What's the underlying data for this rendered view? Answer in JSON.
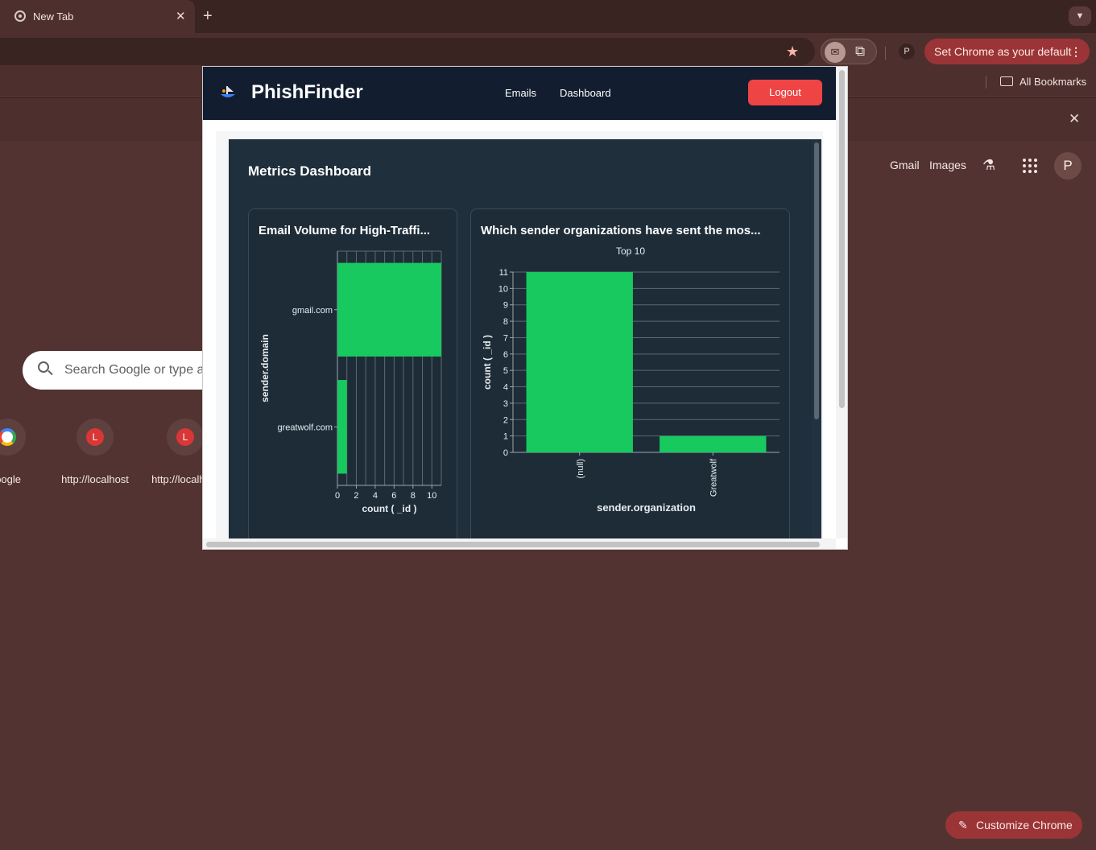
{
  "browser": {
    "tab_title": "New Tab",
    "default_button": "Set Chrome as your default",
    "profile_initial": "P",
    "all_bookmarks": "All Bookmarks"
  },
  "ntp": {
    "gmail": "Gmail",
    "images": "Images",
    "avatar": "P",
    "search_placeholder": "Search Google or type a URL",
    "shortcuts": [
      {
        "label": "Google"
      },
      {
        "label": "http://localhost",
        "letter": "L"
      },
      {
        "label": "http://localhost",
        "letter": "L"
      }
    ],
    "customize": "Customize Chrome"
  },
  "app": {
    "brand": "PhishFinder",
    "nav": {
      "emails": "Emails",
      "dashboard": "Dashboard"
    },
    "logout": "Logout",
    "dashboard_title": "Metrics Dashboard",
    "colors": {
      "bar": "#17c95e",
      "header": "#121d2f",
      "logout": "#ef4444"
    }
  },
  "chart_data": [
    {
      "type": "bar",
      "orientation": "horizontal",
      "title": "Email Volume for High-Traffi...",
      "categories": [
        "gmail.com",
        "greatwolf.com"
      ],
      "values": [
        11,
        1
      ],
      "xlabel": "count ( _id )",
      "ylabel": "sender.domain",
      "xlim": [
        0,
        11
      ],
      "xticks": [
        0,
        2,
        4,
        6,
        8,
        10
      ],
      "grid": true
    },
    {
      "type": "bar",
      "title": "Which sender organizations have sent the mos...",
      "subtitle": "Top 10",
      "categories": [
        "(null)",
        "Greatwolf"
      ],
      "values": [
        11,
        1
      ],
      "xlabel": "sender.organization",
      "ylabel": "count ( _id )",
      "ylim": [
        0,
        11
      ],
      "yticks": [
        0,
        1,
        2,
        3,
        4,
        5,
        6,
        7,
        8,
        9,
        10,
        11
      ],
      "grid": true
    }
  ]
}
